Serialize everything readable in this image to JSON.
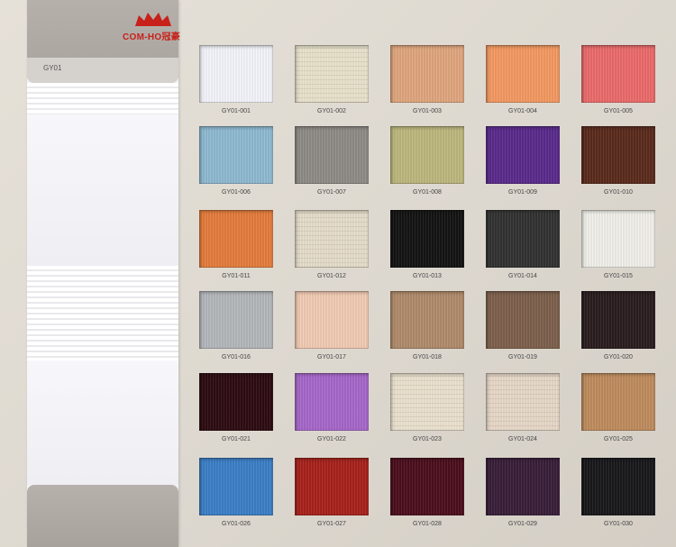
{
  "strip": {
    "brand_name": "COM-HO冠豪",
    "code": "GY01"
  },
  "swatches": [
    {
      "code": "GY01-001",
      "color": "#f4f5fb"
    },
    {
      "code": "GY01-002",
      "color": "#e0dbc4"
    },
    {
      "code": "GY01-003",
      "color": "#e0a77f"
    },
    {
      "code": "GY01-004",
      "color": "#f49a63"
    },
    {
      "code": "GY01-005",
      "color": "#ec6c6c"
    },
    {
      "code": "GY01-006",
      "color": "#8fbad3"
    },
    {
      "code": "GY01-007",
      "color": "#8f8b86"
    },
    {
      "code": "GY01-008",
      "color": "#bdb87e"
    },
    {
      "code": "GY01-009",
      "color": "#5a2b8c"
    },
    {
      "code": "GY01-010",
      "color": "#5a2b1c"
    },
    {
      "code": "GY01-011",
      "color": "#e57d3d"
    },
    {
      "code": "GY01-012",
      "color": "#ddd5c3"
    },
    {
      "code": "GY01-013",
      "color": "#141414"
    },
    {
      "code": "GY01-014",
      "color": "#333333"
    },
    {
      "code": "GY01-015",
      "color": "#f1f0ea"
    },
    {
      "code": "GY01-016",
      "color": "#b5b8bc"
    },
    {
      "code": "GY01-017",
      "color": "#f2cbb4"
    },
    {
      "code": "GY01-018",
      "color": "#b08c6c"
    },
    {
      "code": "GY01-019",
      "color": "#7e614d"
    },
    {
      "code": "GY01-020",
      "color": "#2a1d1f"
    },
    {
      "code": "GY01-021",
      "color": "#2d0c12"
    },
    {
      "code": "GY01-022",
      "color": "#a768ca"
    },
    {
      "code": "GY01-023",
      "color": "#e3dac7"
    },
    {
      "code": "GY01-024",
      "color": "#dfd0c1"
    },
    {
      "code": "GY01-025",
      "color": "#c08d5f"
    },
    {
      "code": "GY01-026",
      "color": "#3c7fc7"
    },
    {
      "code": "GY01-027",
      "color": "#a8221c"
    },
    {
      "code": "GY01-028",
      "color": "#4d0f1d"
    },
    {
      "code": "GY01-029",
      "color": "#3a1f3a"
    },
    {
      "code": "GY01-030",
      "color": "#19191c"
    }
  ]
}
